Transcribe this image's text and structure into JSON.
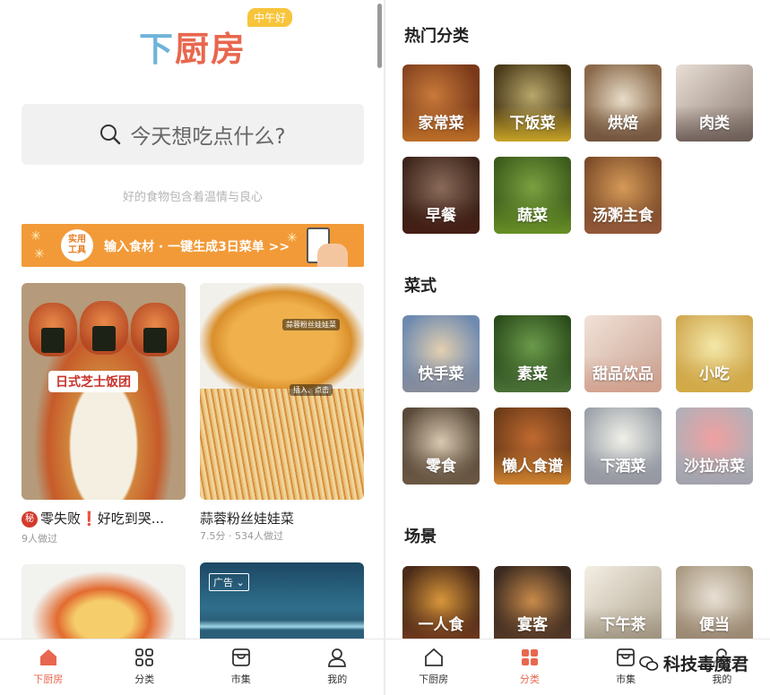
{
  "left": {
    "logo": {
      "part1": "下",
      "part2": "厨",
      "part3": "房"
    },
    "time_badge": "中午好",
    "search": {
      "placeholder": "今天想吃点什么?"
    },
    "slogan": "好的食物包含着温情与良心",
    "banner": {
      "badge": "实用工具",
      "text": "输入食材 · 一键生成3日菜单 >>"
    },
    "cards": [
      {
        "image_label": "日式芝士饭团",
        "secret_badge": "秘",
        "title": "零失败",
        "title_suffix": "好吃到哭...",
        "meta": "9人做过"
      },
      {
        "image_tags": [
          "蒜蓉粉丝娃娃菜",
          "插入、点击"
        ],
        "title": "蒜蓉粉丝娃娃菜",
        "meta": "7.5分 · 534人做过"
      }
    ],
    "ad_tag": "广告",
    "tabs": [
      {
        "label": "下厨房",
        "active": true
      },
      {
        "label": "分类",
        "active": false
      },
      {
        "label": "市集",
        "active": false
      },
      {
        "label": "我的",
        "active": false
      }
    ]
  },
  "right": {
    "sections": [
      {
        "title": "热门分类",
        "items": [
          "家常菜",
          "下饭菜",
          "烘焙",
          "肉类",
          "早餐",
          "蔬菜",
          "汤粥主食"
        ]
      },
      {
        "title": "菜式",
        "items": [
          "快手菜",
          "素菜",
          "甜品饮品",
          "小吃",
          "零食",
          "懒人食谱",
          "下酒菜",
          "沙拉凉菜"
        ]
      },
      {
        "title": "场景",
        "items": [
          "一人食",
          "宴客",
          "下午茶",
          "便当"
        ]
      }
    ],
    "tabs": [
      {
        "label": "下厨房",
        "active": false
      },
      {
        "label": "分类",
        "active": true
      },
      {
        "label": "市集",
        "active": false
      },
      {
        "label": "我的",
        "active": false
      }
    ],
    "watermark": "科技毒魔君"
  },
  "colors": {
    "accent": "#e8674e",
    "logo_blue": "#6fb3d8",
    "banner": "#f29a38",
    "badge_yellow": "#f7c43b"
  }
}
